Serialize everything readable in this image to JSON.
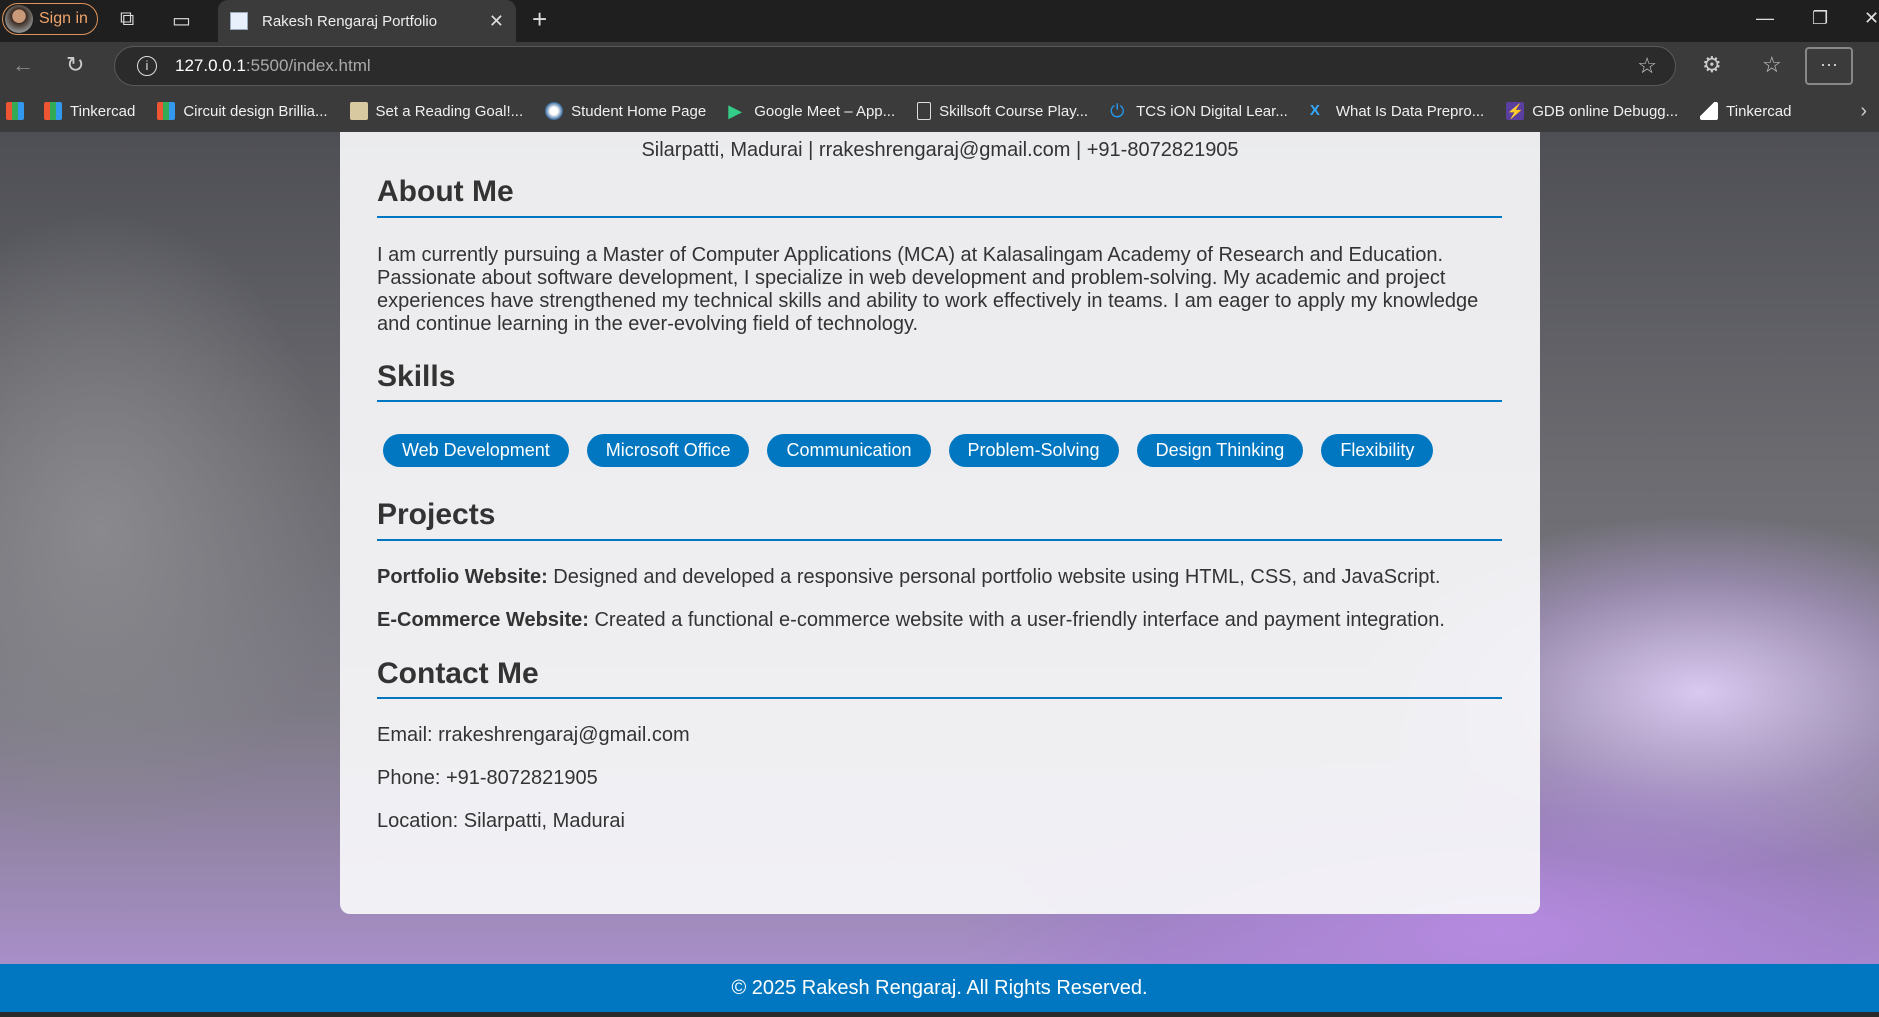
{
  "browser": {
    "signin_label": "Sign in",
    "tab_title": "Rakesh Rengaraj Portfolio",
    "url_host": "127.0.0.1",
    "url_path": ":5500/index.html",
    "bookmarks": [
      {
        "label": "Tinkercad"
      },
      {
        "label": "Circuit design Brillia..."
      },
      {
        "label": "Set a Reading Goal!..."
      },
      {
        "label": "Student Home Page"
      },
      {
        "label": "Google Meet – App..."
      },
      {
        "label": "Skillsoft Course Play..."
      },
      {
        "label": "TCS iON Digital Lear..."
      },
      {
        "label": "What Is Data Prepro..."
      },
      {
        "label": "GDB online Debugg..."
      },
      {
        "label": "Tinkercad"
      }
    ]
  },
  "page": {
    "contact_line": "Silarpatti, Madurai | rrakeshrengaraj@gmail.com | +91-8072821905",
    "about": {
      "title": "About Me",
      "lines": [
        "I am currently pursuing a Master of Computer Applications (MCA) at Kalasalingam Academy of Research and Education.",
        "Passionate about software development, I specialize in web development and problem-solving. My academic and project",
        "experiences have strengthened my technical skills and ability to work effectively in teams. I am eager to apply my knowledge",
        "and continue learning in the ever-evolving field of technology."
      ]
    },
    "skills": {
      "title": "Skills",
      "items": [
        "Web Development",
        "Microsoft Office",
        "Communication",
        "Problem-Solving",
        "Design Thinking",
        "Flexibility"
      ]
    },
    "projects": {
      "title": "Projects",
      "items": [
        {
          "name": "Portfolio Website:",
          "desc": " Designed and developed a responsive personal portfolio website using HTML, CSS, and JavaScript."
        },
        {
          "name": "E-Commerce Website:",
          "desc": " Created a functional e-commerce website with a user-friendly interface and payment integration."
        }
      ]
    },
    "contact": {
      "title": "Contact Me",
      "email": "Email: rrakeshrengaraj@gmail.com",
      "phone": "Phone: +91-8072821905",
      "location": "Location: Silarpatti, Madurai"
    },
    "footer": "© 2025 Rakesh Rengaraj. All Rights Reserved."
  },
  "colors": {
    "accent": "#0077c0"
  }
}
